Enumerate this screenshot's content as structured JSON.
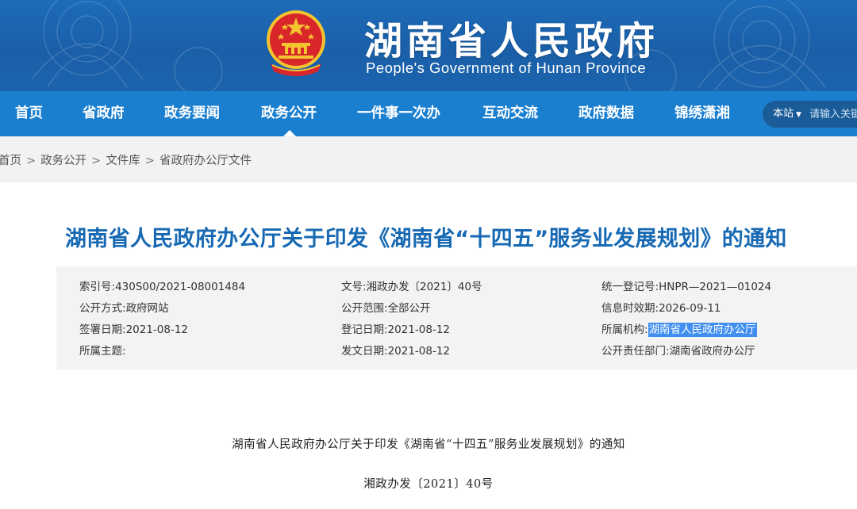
{
  "header": {
    "title": "湖南省人民政府",
    "subtitle": "People's Government of Hunan Province",
    "emblem": "national-emblem-icon",
    "brand_color": "#1b7fd0"
  },
  "nav": {
    "items": [
      {
        "label": "首页"
      },
      {
        "label": "省政府"
      },
      {
        "label": "政务要闻"
      },
      {
        "label": "政务公开",
        "active": true
      },
      {
        "label": "一件事一次办"
      },
      {
        "label": "互动交流"
      },
      {
        "label": "政府数据"
      },
      {
        "label": "锦绣潇湘"
      }
    ],
    "search": {
      "scope": "本站",
      "placeholder": "请输入关键"
    }
  },
  "breadcrumb": {
    "items": [
      "首页",
      "政务公开",
      "文件库",
      "省政府办公厅文件"
    ],
    "separator": ">"
  },
  "article": {
    "title": "湖南省人民政府办公厅关于印发《湖南省“十四五”服务业发展规划》的通知",
    "title_color": "#1769b3"
  },
  "meta": {
    "index_no": {
      "label": "索引号:",
      "value": "430S00/2021-08001484"
    },
    "doc_no": {
      "label": "文号:",
      "value": "湘政办发〔2021〕40号"
    },
    "reg_no": {
      "label": "统一登记号:",
      "value": "HNPR—2021—01024"
    },
    "publish_method": {
      "label": "公开方式:",
      "value": "政府网站"
    },
    "publish_scope": {
      "label": "公开范围:",
      "value": "全部公开"
    },
    "valid_until": {
      "label": "信息时效期:",
      "value": "2026-09-11"
    },
    "sign_date": {
      "label": "签署日期:",
      "value": "2021-08-12"
    },
    "register_date": {
      "label": "登记日期:",
      "value": "2021-08-12"
    },
    "organization": {
      "label": "所属机构:",
      "value": "湖南省人民政府办公厅"
    },
    "topic": {
      "label": "所属主题:",
      "value": ""
    },
    "issue_date": {
      "label": "发文日期:",
      "value": "2021-08-12"
    },
    "responsible_dept": {
      "label": "公开责任部门:",
      "value": "湖南省政府办公厅"
    }
  },
  "document": {
    "heading": "湖南省人民政府办公厅关于印发《湖南省“十四五”服务业发展规划》的通知",
    "number": "湘政办发〔2021〕40号"
  }
}
